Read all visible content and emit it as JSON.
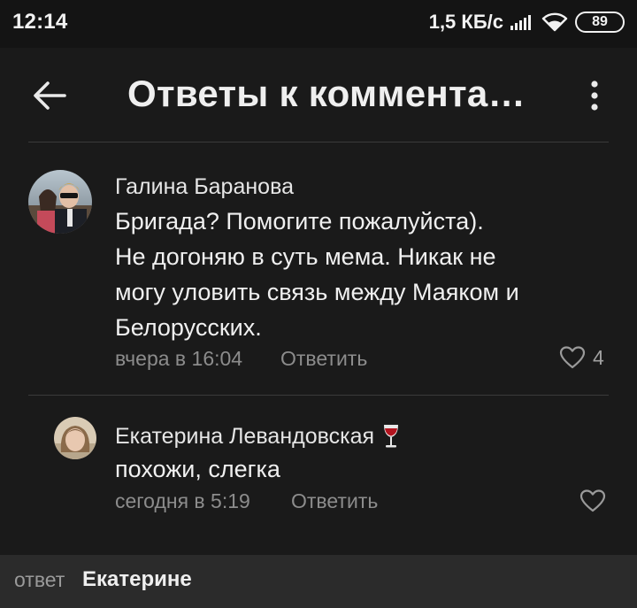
{
  "status_bar": {
    "time": "12:14",
    "speed": "1,5 КБ/с",
    "battery": "89",
    "icons": [
      "signal-icon",
      "wifi-icon",
      "battery-icon"
    ]
  },
  "header": {
    "title": "Ответы к коммента…",
    "back_icon": "arrow-left-icon",
    "menu_icon": "more-vertical-icon"
  },
  "comments": [
    {
      "author": "Галина Баранова",
      "text_lines": [
        "Бригада? Помогите пожалуйста).",
        "Не догоняю в суть мема. Никак не",
        "могу уловить связь между Маяком и",
        "Белорусских."
      ],
      "time": "вчера в 16:04",
      "reply_label": "Ответить",
      "likes": "4"
    },
    {
      "author": "Екатерина Левандовская",
      "author_emoji": "wine-glass-icon",
      "text_lines": [
        "похожи, слегка"
      ],
      "time": "сегодня в 5:19",
      "reply_label": "Ответить",
      "likes": ""
    }
  ],
  "reply_bar": {
    "prefix": "ответ",
    "target": "Екатерине"
  },
  "colors": {
    "background": "#1a1a1a",
    "status_bar": "#141414",
    "reply_bar": "#2b2b2b",
    "text_primary": "#f0f0f0",
    "text_secondary": "#8c8c8c",
    "divider": "#3a3a3a"
  }
}
